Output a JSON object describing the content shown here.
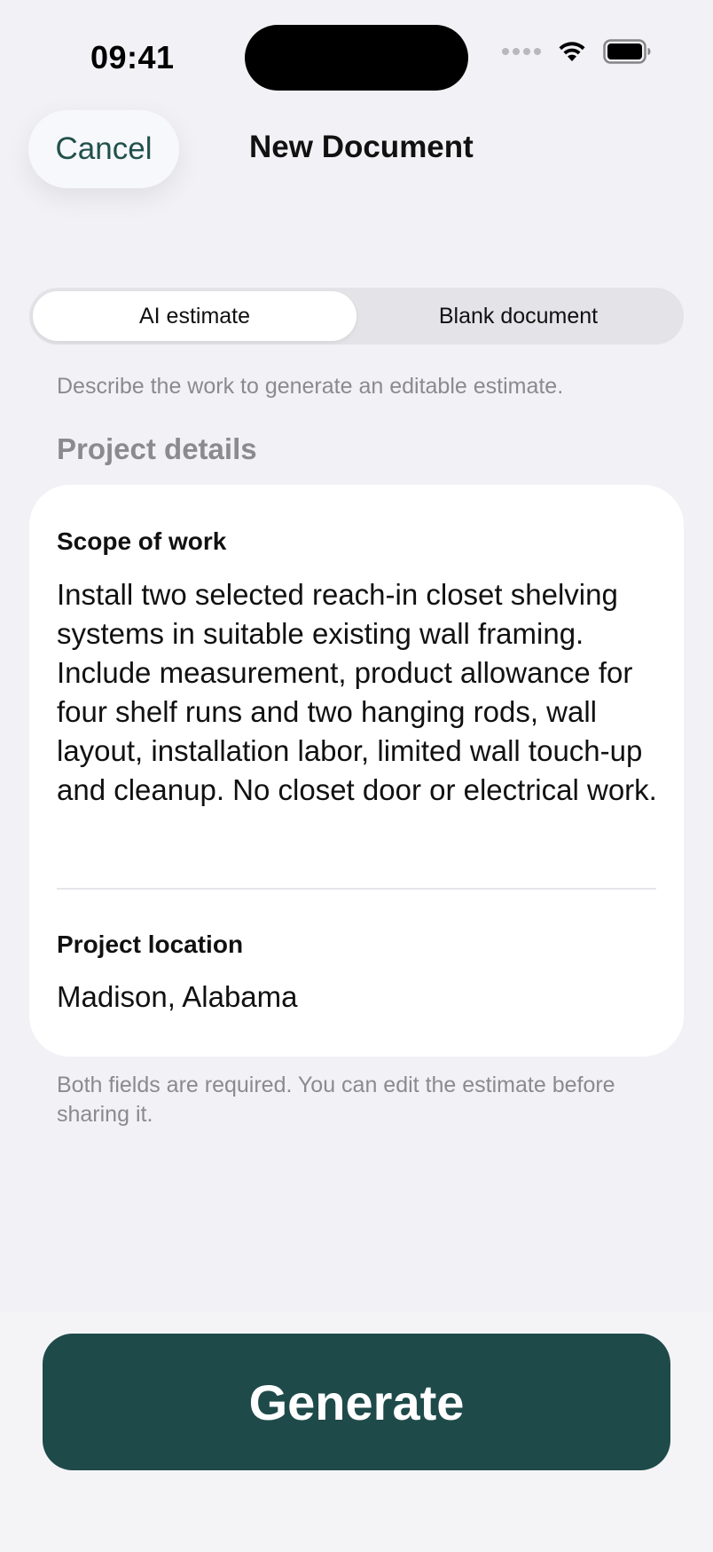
{
  "status_bar": {
    "time": "09:41"
  },
  "nav": {
    "cancel_label": "Cancel",
    "title": "New Document"
  },
  "segmented": {
    "options": [
      "AI estimate",
      "Blank document"
    ],
    "selected": "AI estimate"
  },
  "helper_text": "Describe the work to generate an editable estimate.",
  "section_header": "Project details",
  "form": {
    "scope_label": "Scope of work",
    "scope_value": "Install two selected reach-in closet shelving systems in suitable existing wall framing. Include measurement, product allowance for four shelf runs and two hanging rods, wall layout, installation labor, limited wall touch-up and cleanup. No closet door or electrical work.",
    "location_label": "Project location",
    "location_value": "Madison, Alabama"
  },
  "footnote": "Both fields are required. You can edit the estimate before sharing it.",
  "generate_label": "Generate",
  "colors": {
    "accent": "#1f4a4a",
    "cancel_text": "#21514d",
    "background": "#f2f2f6"
  },
  "icons": [
    "signal-icon",
    "wifi-icon",
    "battery-icon"
  ]
}
